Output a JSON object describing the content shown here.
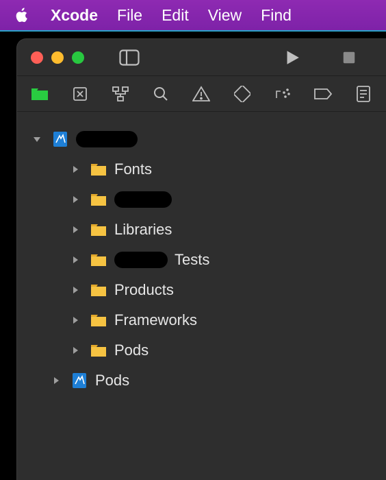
{
  "menubar": {
    "app_name": "Xcode",
    "items": [
      "File",
      "Edit",
      "View",
      "Find"
    ]
  },
  "colors": {
    "menubar_bg": "#7e22a8",
    "window_bg": "#2e2e2e",
    "accent_green": "#29cc41",
    "folder": "#f6c342",
    "proj_icon": "#1e7fd6",
    "text": "#e6e6e6",
    "icon_grey": "#bfbfbf"
  },
  "tree": {
    "root": {
      "name_redacted": true
    },
    "children": [
      {
        "label": "Fonts",
        "redacted_before": false,
        "redacted_width": ""
      },
      {
        "label": "",
        "redacted_before": false,
        "redacted_width": "w84",
        "full_redact": true
      },
      {
        "label": "Libraries",
        "redacted_before": false
      },
      {
        "label": "Tests",
        "redacted_before": true,
        "redacted_width": "w78"
      },
      {
        "label": "Products",
        "redacted_before": false
      },
      {
        "label": "Frameworks",
        "redacted_before": false
      },
      {
        "label": "Pods",
        "redacted_before": false
      }
    ],
    "sibling": {
      "label": "Pods"
    }
  }
}
